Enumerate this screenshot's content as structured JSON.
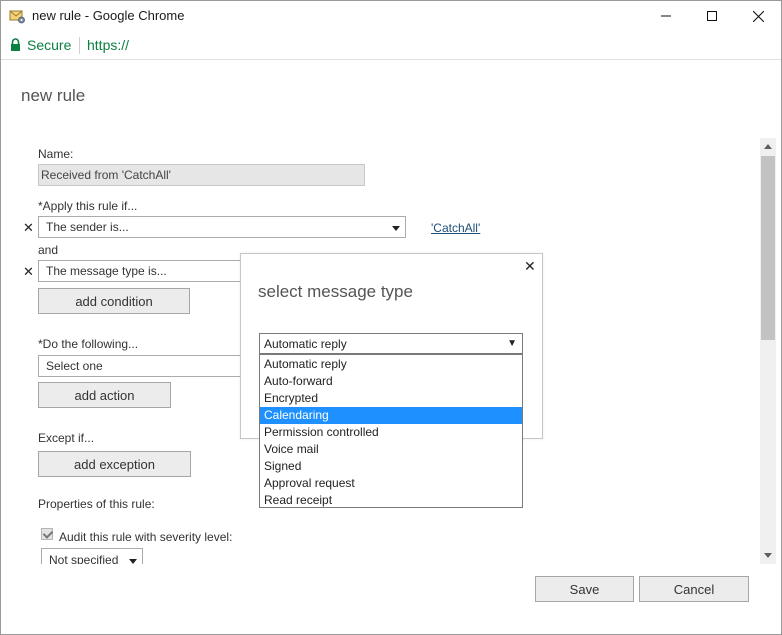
{
  "window": {
    "title": "new rule - Google Chrome",
    "app_icon": "mail-rules-icon",
    "controls": {
      "minimize_icon": "minimize-icon",
      "maximize_icon": "maximize-icon",
      "close_icon": "close-icon"
    }
  },
  "addressbar": {
    "lock_icon": "lock-icon",
    "secure_label": "Secure",
    "url": "https://"
  },
  "page": {
    "title": "new rule",
    "name": {
      "label": "Name:",
      "value": "Received from 'CatchAll'"
    },
    "apply": {
      "label": "*Apply this rule if...",
      "condition1": "The sender is...",
      "condition1_link": "'CatchAll'",
      "and_label": "and",
      "condition2": "The message type is...",
      "add_condition": "add condition"
    },
    "do": {
      "label": "*Do the following...",
      "action": "Select one",
      "add_action": "add action"
    },
    "except": {
      "label": "Except if...",
      "add_exception": "add exception"
    },
    "properties": {
      "label": "Properties of this rule:",
      "audit_label": "Audit this rule with severity level:",
      "audit_checked": true,
      "severity": "Not specified"
    }
  },
  "modal": {
    "title": "select message type",
    "close_icon": "close-icon",
    "select": {
      "value": "Automatic reply",
      "arrow": "▼",
      "options": [
        "Automatic reply",
        "Auto-forward",
        "Encrypted",
        "Calendaring",
        "Permission controlled",
        "Voice mail",
        "Signed",
        "Approval request",
        "Read receipt"
      ],
      "highlighted": "Calendaring"
    }
  },
  "footer": {
    "save": "Save",
    "cancel": "Cancel"
  },
  "colors": {
    "secure_green": "#0b8043",
    "link_blue": "#1e4e79",
    "highlight_blue": "#1e90ff"
  }
}
